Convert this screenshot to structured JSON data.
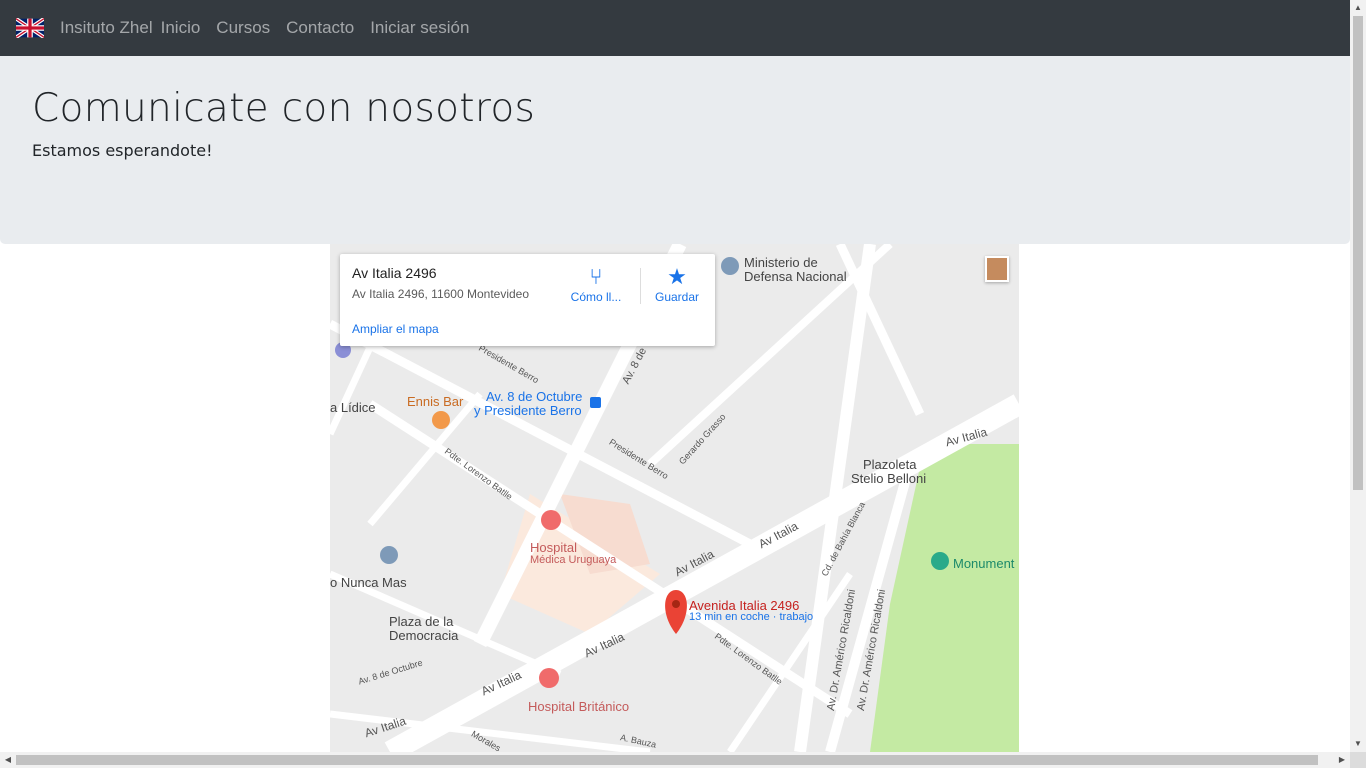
{
  "nav": {
    "brand": "Insituto Zhel",
    "links": [
      "Inicio",
      "Cursos",
      "Contacto",
      "Iniciar sesión"
    ]
  },
  "jumbotron": {
    "title": "Comunicate con nosotros",
    "subtitle": "Estamos esperandote!"
  },
  "map": {
    "card": {
      "title": "Av Italia 2496",
      "address": "Av Italia 2496, 11600 Montevideo",
      "directions": "Cómo ll...",
      "save": "Guardar",
      "enlarge": "Ampliar el mapa"
    },
    "labels": {
      "ministerio1": "Ministerio de",
      "ministerio2": "Defensa Nacional",
      "ennis": "Ennis Bar",
      "stop1": "Av. 8 de Octubre",
      "stop2": "y Presidente Berro",
      "lidice": "a Lídice",
      "hospital1": "Hospital",
      "hospital2": "Médica Uruguaya",
      "plazoleta1": "Plazoleta",
      "plazoleta2": "Stelio Belloni",
      "monumento": "Monument",
      "nunca": "o Nunca Mas",
      "plaza1": "Plaza de la",
      "plaza2": "Democracia",
      "marker": "Avenida Italia 2496",
      "marker_sub": "13 min en coche · trabajo",
      "britanico": "Hospital Británico",
      "st_italia1": "Av Italia",
      "st_italia2": "Av Italia",
      "st_italia3": "Av Italia",
      "st_italia4": "Av Italia",
      "st_italia5": "Av Italia",
      "st_italia6": "Av Italia",
      "st_8oct": "Av. 8 de",
      "st_8oct2": "Av. 8 de Octubre",
      "st_pberro": "Presidente Berro",
      "st_pberro2": "Presidente Berro",
      "st_lorenzo": "Pdte. Lorenzo Batlle",
      "st_lorenzo2": "Pdte. Lorenzo Batlle",
      "st_grasso": "Gerardo Grasso",
      "st_bahia": "Cd. de Bahía Blanca",
      "st_ricaldoni1": "Av. Dr. Américo Ricaldoni",
      "st_ricaldoni2": "Av. Dr. Américo Ricaldoni",
      "st_morales": "Morales",
      "st_bauza": "A. Bauza"
    }
  }
}
